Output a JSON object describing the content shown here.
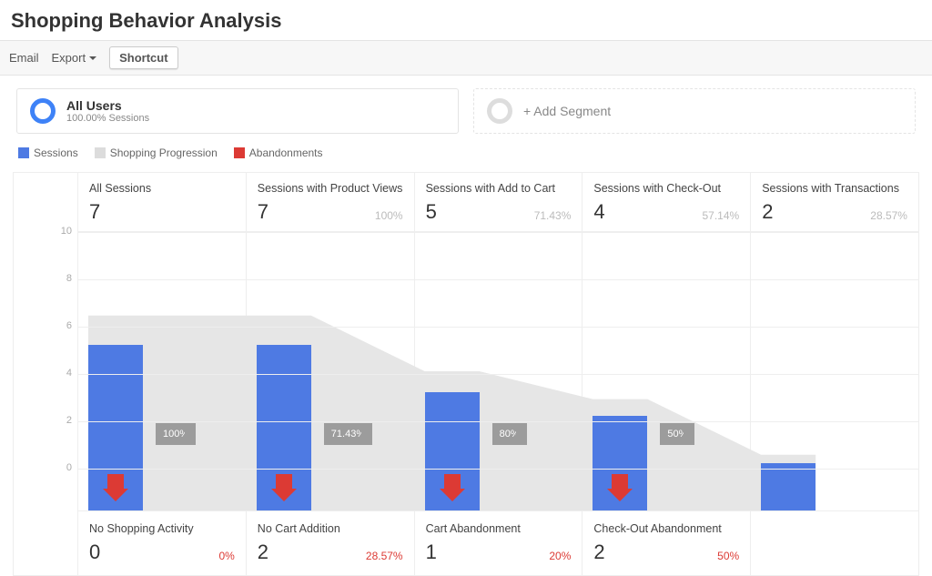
{
  "title": "Shopping Behavior Analysis",
  "toolbar": {
    "email": "Email",
    "export": "Export",
    "shortcut": "Shortcut"
  },
  "segments": {
    "primary": {
      "title": "All Users",
      "sub": "100.00% Sessions"
    },
    "add": {
      "label": "+ Add Segment"
    }
  },
  "legend": {
    "a": "Sessions",
    "b": "Shopping Progression",
    "c": "Abandonments"
  },
  "axis": {
    "max": 10,
    "step": 2
  },
  "stages": [
    {
      "title": "All Sessions",
      "value": 7,
      "pct": "",
      "progress": "100%"
    },
    {
      "title": "Sessions with Product Views",
      "value": 7,
      "pct": "100%",
      "progress": "71.43%"
    },
    {
      "title": "Sessions with Add to Cart",
      "value": 5,
      "pct": "71.43%",
      "progress": "80%"
    },
    {
      "title": "Sessions with Check-Out",
      "value": 4,
      "pct": "57.14%",
      "progress": "50%"
    },
    {
      "title": "Sessions with Transactions",
      "value": 2,
      "pct": "28.57%",
      "progress": ""
    }
  ],
  "band_y": 210,
  "abandon": [
    {
      "title": "No Shopping Activity",
      "value": 0,
      "pct": "0%"
    },
    {
      "title": "No Cart Addition",
      "value": 2,
      "pct": "28.57%"
    },
    {
      "title": "Cart Abandonment",
      "value": 1,
      "pct": "20%"
    },
    {
      "title": "Check-Out Abandonment",
      "value": 2,
      "pct": "50%"
    }
  ],
  "chart_data": {
    "type": "bar",
    "title": "Shopping Behavior Analysis",
    "categories": [
      "All Sessions",
      "Sessions with Product Views",
      "Sessions with Add to Cart",
      "Sessions with Check-Out",
      "Sessions with Transactions"
    ],
    "series": [
      {
        "name": "Sessions",
        "values": [
          7,
          7,
          5,
          4,
          2
        ]
      },
      {
        "name": "Shopping Progression %",
        "values": [
          100,
          71.43,
          80,
          50,
          null
        ]
      },
      {
        "name": "Abandonments",
        "values": [
          0,
          2,
          1,
          2,
          null
        ]
      },
      {
        "name": "Abandonment %",
        "values": [
          0,
          28.57,
          20,
          50,
          null
        ]
      }
    ],
    "ylim": [
      0,
      10
    ],
    "ylabel": "Sessions",
    "xlabel": ""
  }
}
